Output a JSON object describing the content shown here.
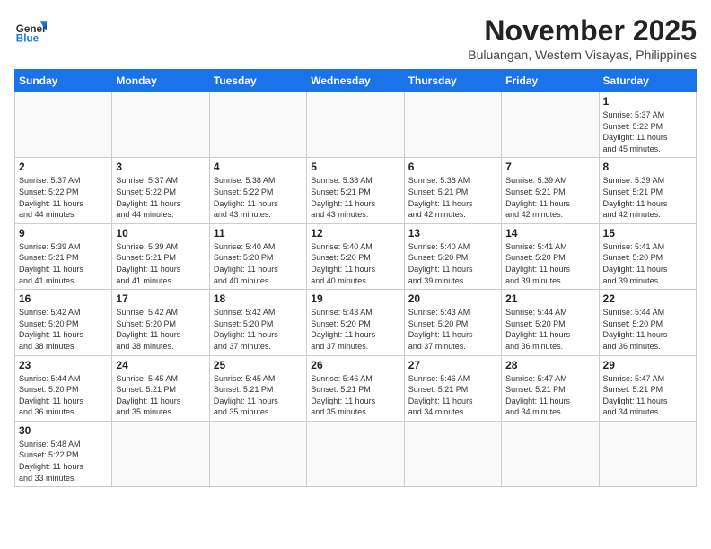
{
  "header": {
    "logo_general": "General",
    "logo_blue": "Blue",
    "month_year": "November 2025",
    "location": "Buluangan, Western Visayas, Philippines"
  },
  "weekdays": [
    "Sunday",
    "Monday",
    "Tuesday",
    "Wednesday",
    "Thursday",
    "Friday",
    "Saturday"
  ],
  "weeks": [
    [
      {
        "day": "",
        "info": ""
      },
      {
        "day": "",
        "info": ""
      },
      {
        "day": "",
        "info": ""
      },
      {
        "day": "",
        "info": ""
      },
      {
        "day": "",
        "info": ""
      },
      {
        "day": "",
        "info": ""
      },
      {
        "day": "1",
        "info": "Sunrise: 5:37 AM\nSunset: 5:22 PM\nDaylight: 11 hours\nand 45 minutes."
      }
    ],
    [
      {
        "day": "2",
        "info": "Sunrise: 5:37 AM\nSunset: 5:22 PM\nDaylight: 11 hours\nand 44 minutes."
      },
      {
        "day": "3",
        "info": "Sunrise: 5:37 AM\nSunset: 5:22 PM\nDaylight: 11 hours\nand 44 minutes."
      },
      {
        "day": "4",
        "info": "Sunrise: 5:38 AM\nSunset: 5:22 PM\nDaylight: 11 hours\nand 43 minutes."
      },
      {
        "day": "5",
        "info": "Sunrise: 5:38 AM\nSunset: 5:21 PM\nDaylight: 11 hours\nand 43 minutes."
      },
      {
        "day": "6",
        "info": "Sunrise: 5:38 AM\nSunset: 5:21 PM\nDaylight: 11 hours\nand 42 minutes."
      },
      {
        "day": "7",
        "info": "Sunrise: 5:39 AM\nSunset: 5:21 PM\nDaylight: 11 hours\nand 42 minutes."
      },
      {
        "day": "8",
        "info": "Sunrise: 5:39 AM\nSunset: 5:21 PM\nDaylight: 11 hours\nand 42 minutes."
      }
    ],
    [
      {
        "day": "9",
        "info": "Sunrise: 5:39 AM\nSunset: 5:21 PM\nDaylight: 11 hours\nand 41 minutes."
      },
      {
        "day": "10",
        "info": "Sunrise: 5:39 AM\nSunset: 5:21 PM\nDaylight: 11 hours\nand 41 minutes."
      },
      {
        "day": "11",
        "info": "Sunrise: 5:40 AM\nSunset: 5:20 PM\nDaylight: 11 hours\nand 40 minutes."
      },
      {
        "day": "12",
        "info": "Sunrise: 5:40 AM\nSunset: 5:20 PM\nDaylight: 11 hours\nand 40 minutes."
      },
      {
        "day": "13",
        "info": "Sunrise: 5:40 AM\nSunset: 5:20 PM\nDaylight: 11 hours\nand 39 minutes."
      },
      {
        "day": "14",
        "info": "Sunrise: 5:41 AM\nSunset: 5:20 PM\nDaylight: 11 hours\nand 39 minutes."
      },
      {
        "day": "15",
        "info": "Sunrise: 5:41 AM\nSunset: 5:20 PM\nDaylight: 11 hours\nand 39 minutes."
      }
    ],
    [
      {
        "day": "16",
        "info": "Sunrise: 5:42 AM\nSunset: 5:20 PM\nDaylight: 11 hours\nand 38 minutes."
      },
      {
        "day": "17",
        "info": "Sunrise: 5:42 AM\nSunset: 5:20 PM\nDaylight: 11 hours\nand 38 minutes."
      },
      {
        "day": "18",
        "info": "Sunrise: 5:42 AM\nSunset: 5:20 PM\nDaylight: 11 hours\nand 37 minutes."
      },
      {
        "day": "19",
        "info": "Sunrise: 5:43 AM\nSunset: 5:20 PM\nDaylight: 11 hours\nand 37 minutes."
      },
      {
        "day": "20",
        "info": "Sunrise: 5:43 AM\nSunset: 5:20 PM\nDaylight: 11 hours\nand 37 minutes."
      },
      {
        "day": "21",
        "info": "Sunrise: 5:44 AM\nSunset: 5:20 PM\nDaylight: 11 hours\nand 36 minutes."
      },
      {
        "day": "22",
        "info": "Sunrise: 5:44 AM\nSunset: 5:20 PM\nDaylight: 11 hours\nand 36 minutes."
      }
    ],
    [
      {
        "day": "23",
        "info": "Sunrise: 5:44 AM\nSunset: 5:20 PM\nDaylight: 11 hours\nand 36 minutes."
      },
      {
        "day": "24",
        "info": "Sunrise: 5:45 AM\nSunset: 5:21 PM\nDaylight: 11 hours\nand 35 minutes."
      },
      {
        "day": "25",
        "info": "Sunrise: 5:45 AM\nSunset: 5:21 PM\nDaylight: 11 hours\nand 35 minutes."
      },
      {
        "day": "26",
        "info": "Sunrise: 5:46 AM\nSunset: 5:21 PM\nDaylight: 11 hours\nand 35 minutes."
      },
      {
        "day": "27",
        "info": "Sunrise: 5:46 AM\nSunset: 5:21 PM\nDaylight: 11 hours\nand 34 minutes."
      },
      {
        "day": "28",
        "info": "Sunrise: 5:47 AM\nSunset: 5:21 PM\nDaylight: 11 hours\nand 34 minutes."
      },
      {
        "day": "29",
        "info": "Sunrise: 5:47 AM\nSunset: 5:21 PM\nDaylight: 11 hours\nand 34 minutes."
      }
    ],
    [
      {
        "day": "30",
        "info": "Sunrise: 5:48 AM\nSunset: 5:22 PM\nDaylight: 11 hours\nand 33 minutes."
      },
      {
        "day": "",
        "info": ""
      },
      {
        "day": "",
        "info": ""
      },
      {
        "day": "",
        "info": ""
      },
      {
        "day": "",
        "info": ""
      },
      {
        "day": "",
        "info": ""
      },
      {
        "day": "",
        "info": ""
      }
    ]
  ]
}
